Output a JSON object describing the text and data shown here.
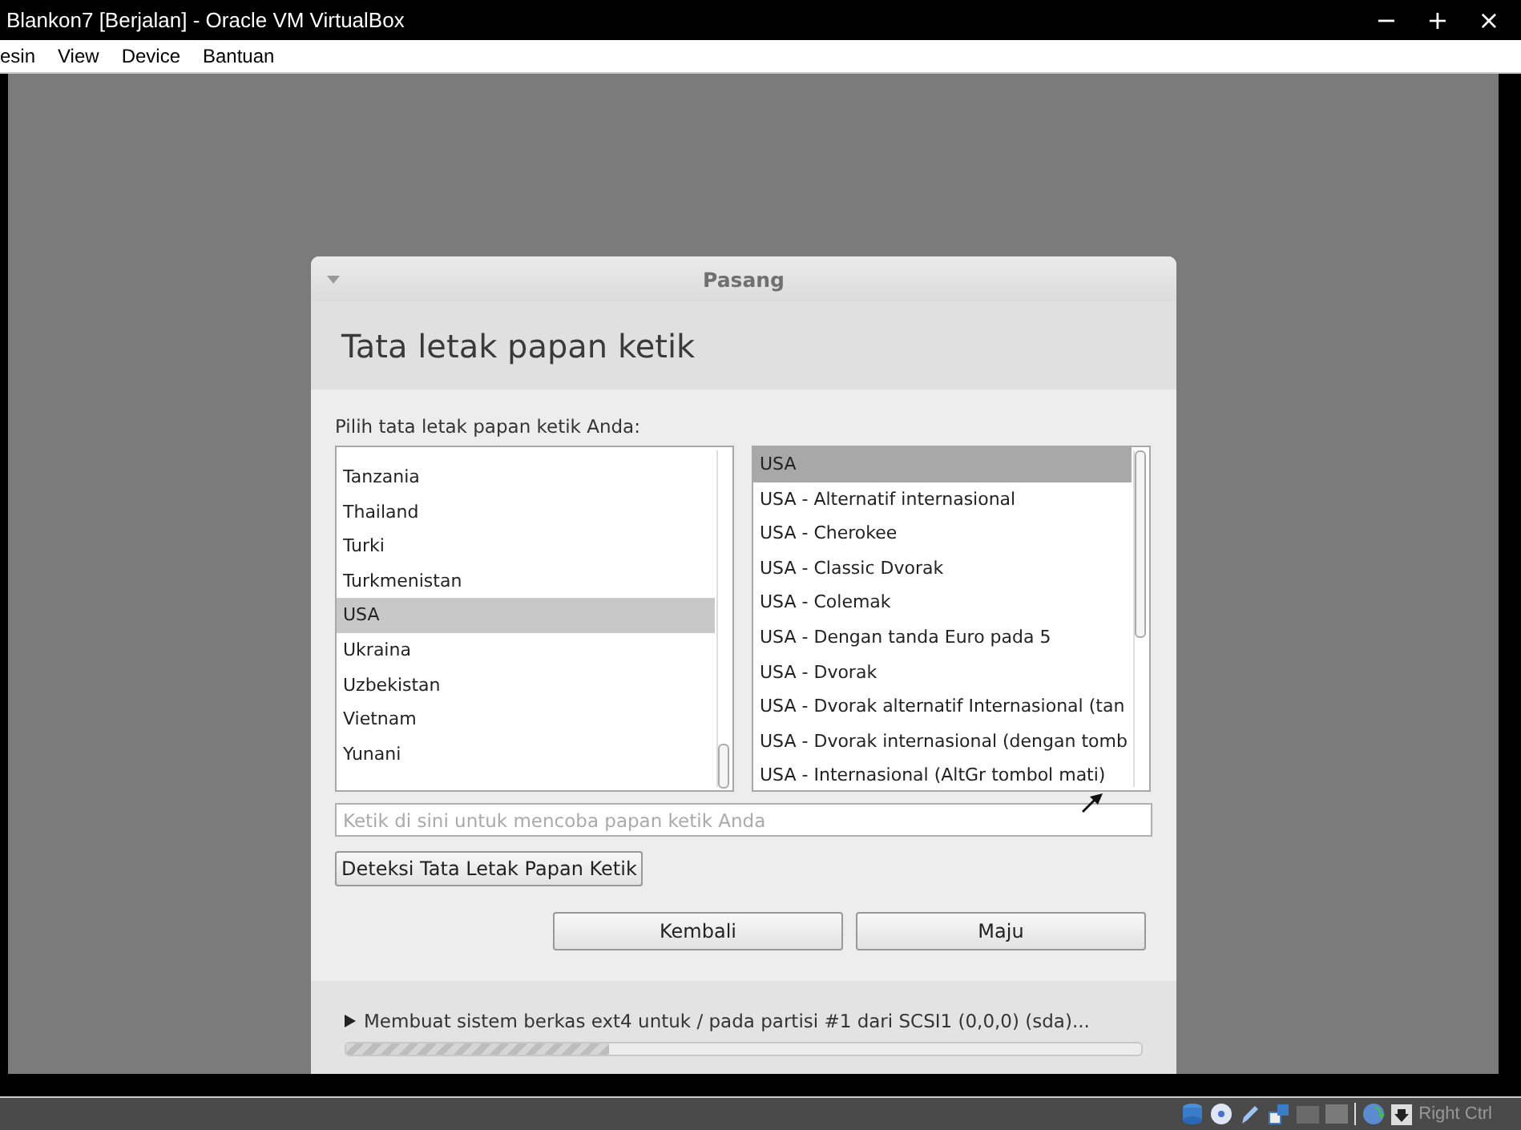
{
  "window": {
    "title": "Blankon7 [Berjalan] - Oracle VM VirtualBox",
    "controls": [
      "−",
      "+",
      "×"
    ]
  },
  "menu": [
    "esin",
    "View",
    "Device",
    "Bantuan"
  ],
  "dialog": {
    "title": "Pasang",
    "heading": "Tata letak papan ketik",
    "prompt": "Pilih tata letak papan ketik Anda:",
    "countries": [
      {
        "label": "Tanzania",
        "selected": false
      },
      {
        "label": "Thailand",
        "selected": false
      },
      {
        "label": "Turki",
        "selected": false
      },
      {
        "label": "Turkmenistan",
        "selected": false
      },
      {
        "label": "USA",
        "selected": true
      },
      {
        "label": "Ukraina",
        "selected": false
      },
      {
        "label": "Uzbekistan",
        "selected": false
      },
      {
        "label": "Vietnam",
        "selected": false
      },
      {
        "label": "Yunani",
        "selected": false
      }
    ],
    "layouts": [
      {
        "label": "USA",
        "selected": true
      },
      {
        "label": "USA - Alternatif internasional",
        "selected": false
      },
      {
        "label": "USA - Cherokee",
        "selected": false
      },
      {
        "label": "USA - Classic Dvorak",
        "selected": false
      },
      {
        "label": "USA - Colemak",
        "selected": false
      },
      {
        "label": "USA - Dengan tanda Euro pada 5",
        "selected": false
      },
      {
        "label": "USA - Dvorak",
        "selected": false
      },
      {
        "label": "USA - Dvorak alternatif Internasional (tan",
        "selected": false
      },
      {
        "label": "USA - Dvorak internasional (dengan tomb",
        "selected": false
      },
      {
        "label": "USA - Internasional (AltGr tombol mati)",
        "selected": false
      }
    ],
    "test_field": {
      "placeholder": "Ketik di sini untuk mencoba papan ketik Anda"
    },
    "detect_button": "Deteksi Tata Letak Papan Ketik",
    "buttons": [
      "Kembali",
      "Maju"
    ],
    "status": "Membuat sistem berkas ext4 untuk / pada partisi #1 dari SCSI1 (0,0,0) (sda)...",
    "progress": {
      "level": 0.33
    }
  },
  "status_bar": {
    "host_key": "Right Ctrl"
  }
}
